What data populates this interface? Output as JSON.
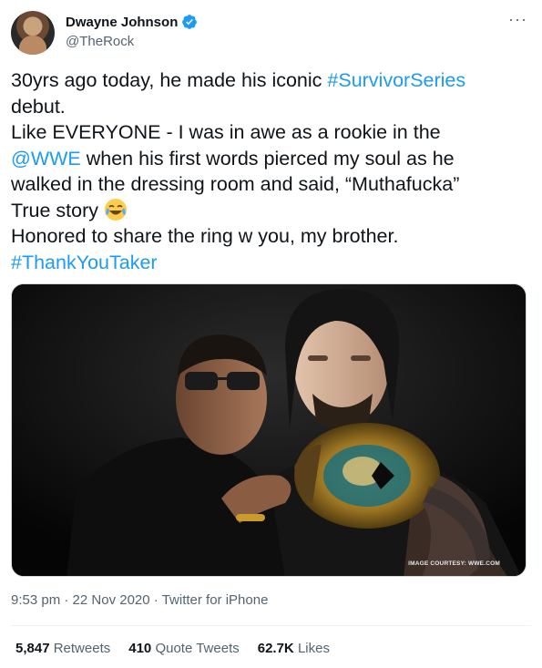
{
  "author": {
    "display_name": "Dwayne Johnson",
    "handle": "@TheRock",
    "verified": true,
    "avatar_icon": "avatar-photo"
  },
  "more_icon": "···",
  "tweet": {
    "lines": [
      [
        {
          "t": "30yrs ago today, he made his iconic "
        },
        {
          "t": "#SurvivorSeries",
          "link": true
        }
      ],
      [
        {
          "t": "debut."
        }
      ],
      [
        {
          "t": "Like EVERYONE - I was in awe as a rookie in the"
        }
      ],
      [
        {
          "t": "@WWE",
          "link": true
        },
        {
          "t": " when his first words pierced my soul as he"
        }
      ],
      [
        {
          "t": "walked in the dressing room and said, “Muthafucka”"
        }
      ],
      [
        {
          "t": "True story "
        },
        {
          "emoji": "face-with-tears-of-joy-icon"
        }
      ],
      [
        {
          "t": "Honored to share the ring w you, my brother."
        }
      ],
      [
        {
          "t": "#ThankYouTaker",
          "link": true
        }
      ]
    ]
  },
  "media": {
    "credit": "IMAGE COURTESY: WWE.COM"
  },
  "meta": {
    "time": "9:53 pm",
    "separator": " · ",
    "date": "22 Nov 2020",
    "source": "Twitter for iPhone"
  },
  "stats": {
    "retweets": {
      "num": "5,847",
      "label": "Retweets"
    },
    "quotes": {
      "num": "410",
      "label": "Quote Tweets"
    },
    "likes": {
      "num": "62.7K",
      "label": "Likes"
    }
  },
  "colors": {
    "link": "#1d9bf0",
    "text": "#0f1419",
    "secondary": "#536471"
  }
}
